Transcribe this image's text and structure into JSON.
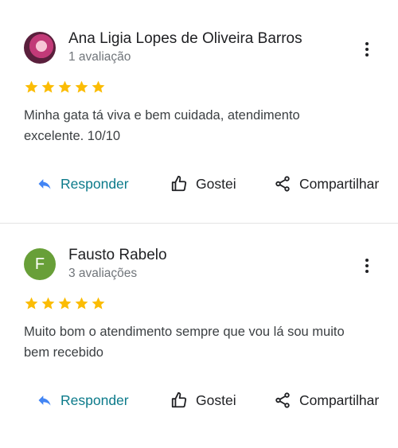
{
  "reviews": [
    {
      "author": "Ana Ligia Lopes de Oliveira Barros",
      "review_count": "1 avaliação",
      "avatar": "profile-photo",
      "rating": 5,
      "text": "Minha gata tá viva e bem cuidada, atendimento excelente. 10/10",
      "actions": {
        "reply": "Responder",
        "like": "Gostei",
        "share": "Compartilhar"
      }
    },
    {
      "author": "Fausto Rabelo",
      "review_count": "3 avaliações",
      "avatar_letter": "F",
      "rating": 5,
      "text": "Muito bom o atendimento sempre que vou lá sou muito bem recebido",
      "actions": {
        "reply": "Responder",
        "like": "Gostei",
        "share": "Compartilhar"
      }
    }
  ],
  "colors": {
    "star": "#fbbc04",
    "reply": "#0b7a8a",
    "reply_icon": "#4285f4",
    "avatar_letter_bg": "#689f38"
  },
  "icons": [
    "more-vert-icon",
    "reply-icon",
    "thumb-up-icon",
    "share-icon",
    "star-icon"
  ]
}
